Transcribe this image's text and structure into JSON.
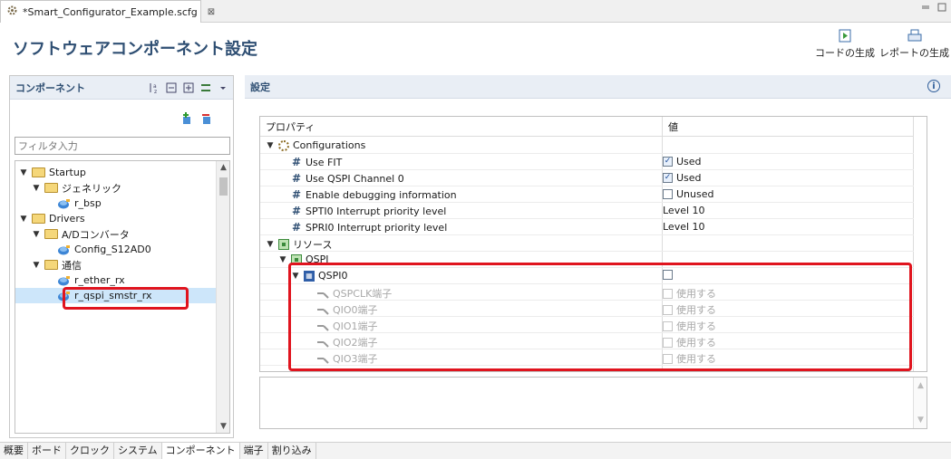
{
  "editor": {
    "tab_title": "*Smart_Configurator_Example.scfg",
    "close": "⊠"
  },
  "header": {
    "title": "ソフトウェアコンポーネント設定",
    "generate_code": "コードの生成",
    "generate_report": "レポートの生成"
  },
  "left": {
    "title": "コンポーネント",
    "filter_placeholder": "フィルタ入力",
    "tree": [
      {
        "label": "Startup",
        "kind": "folder",
        "level": 0,
        "expanded": true
      },
      {
        "label": "ジェネリック",
        "kind": "folder",
        "level": 1,
        "expanded": true
      },
      {
        "label": "r_bsp",
        "kind": "component",
        "level": 2
      },
      {
        "label": "Drivers",
        "kind": "folder",
        "level": 0,
        "expanded": true
      },
      {
        "label": "A/Dコンバータ",
        "kind": "folder",
        "level": 1,
        "expanded": true
      },
      {
        "label": "Config_S12AD0",
        "kind": "component",
        "level": 2
      },
      {
        "label": "通信",
        "kind": "folder",
        "level": 1,
        "expanded": true
      },
      {
        "label": "r_ether_rx",
        "kind": "component",
        "level": 2
      },
      {
        "label": "r_qspi_smstr_rx",
        "kind": "component",
        "level": 2,
        "selected": true
      }
    ]
  },
  "right": {
    "title": "設定",
    "col_property": "プロパティ",
    "col_value": "値",
    "rows": [
      {
        "name": "Configurations",
        "value": "",
        "level": 0,
        "icon": "gear",
        "chev": "open"
      },
      {
        "name": "Use FIT",
        "value": "Used",
        "level": 1,
        "icon": "hash",
        "check": "checked"
      },
      {
        "name": "Use QSPI Channel 0",
        "value": "Used",
        "level": 1,
        "icon": "hash",
        "check": "checked"
      },
      {
        "name": "Enable debugging information",
        "value": "Unused",
        "level": 1,
        "icon": "hash",
        "check": "unchecked"
      },
      {
        "name": "SPTI0 Interrupt priority level",
        "value": "Level 10",
        "level": 1,
        "icon": "hash"
      },
      {
        "name": "SPRI0 Interrupt priority level",
        "value": "Level 10",
        "level": 1,
        "icon": "hash"
      },
      {
        "name": "リソース",
        "value": "",
        "level": 0,
        "icon": "chip",
        "chev": "open"
      },
      {
        "name": "QSPI",
        "value": "",
        "level": 1,
        "icon": "chip",
        "chev": "open"
      },
      {
        "name": "QSPI0",
        "value": "",
        "level": 2,
        "icon": "qspi",
        "chev": "open",
        "check": "unchecked"
      },
      {
        "name": "QSPCLK端子",
        "value": "使用する",
        "level": 3,
        "icon": "pin",
        "check": "disabled",
        "disabled": true
      },
      {
        "name": "QIO0端子",
        "value": "使用する",
        "level": 3,
        "icon": "pin",
        "check": "disabled",
        "disabled": true
      },
      {
        "name": "QIO1端子",
        "value": "使用する",
        "level": 3,
        "icon": "pin",
        "check": "disabled",
        "disabled": true
      },
      {
        "name": "QIO2端子",
        "value": "使用する",
        "level": 3,
        "icon": "pin",
        "check": "disabled",
        "disabled": true
      },
      {
        "name": "QIO3端子",
        "value": "使用する",
        "level": 3,
        "icon": "pin",
        "check": "disabled",
        "disabled": true
      }
    ]
  },
  "bottom_tabs": [
    "概要",
    "ボード",
    "クロック",
    "システム",
    "コンポーネント",
    "端子",
    "割り込み"
  ],
  "bottom_active": "コンポーネント",
  "colors": {
    "highlight": "#e0141e",
    "title": "#2f4f73",
    "selection": "#cde6fa"
  }
}
